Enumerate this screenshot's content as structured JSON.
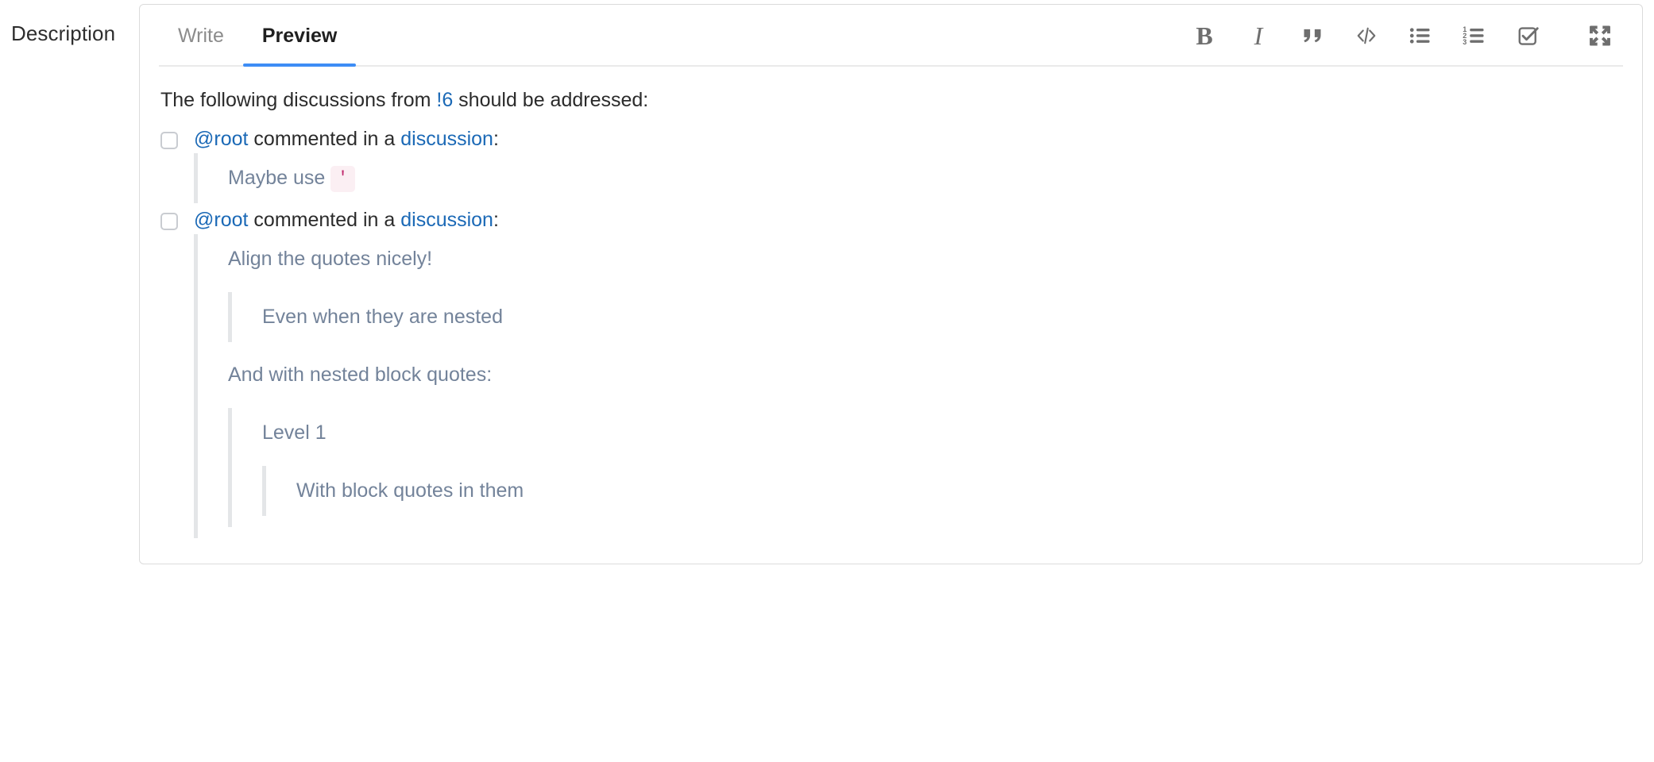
{
  "field": {
    "label": "Description"
  },
  "editor": {
    "tabs": [
      {
        "label": "Write",
        "active": false
      },
      {
        "label": "Preview",
        "active": true
      }
    ],
    "active_tab": "Preview",
    "accent_color": "#3d8df5",
    "toolbar": [
      {
        "name": "bold-icon",
        "label": "B",
        "title": "Add bold text"
      },
      {
        "name": "italic-icon",
        "label": "I",
        "title": "Add italic text"
      },
      {
        "name": "quote-icon",
        "label": "”",
        "title": "Insert a quote"
      },
      {
        "name": "code-icon",
        "label": "</>",
        "title": "Insert code"
      },
      {
        "name": "bullet-list-icon",
        "label": "",
        "title": "Add a bullet list"
      },
      {
        "name": "numbered-list-icon",
        "label": "",
        "title": "Add a numbered list"
      },
      {
        "name": "task-list-icon",
        "label": "",
        "title": "Add a task list"
      },
      {
        "name": "fullscreen-icon",
        "label": "",
        "title": "Go full screen"
      }
    ]
  },
  "preview": {
    "intro": {
      "before": "The following discussions from ",
      "link": "!6",
      "after": " should be addressed:"
    },
    "tasks": [
      {
        "checked": false,
        "user": "@root",
        "mid": " commented in a ",
        "link": "discussion",
        "tail": ":",
        "quote": {
          "text_before_code": "Maybe use ",
          "code": "'",
          "nested": []
        }
      },
      {
        "checked": false,
        "user": "@root",
        "mid": " commented in a ",
        "link": "discussion",
        "tail": ":",
        "quote": {
          "line1": "Align the quotes nicely!",
          "nested1": "Even when they are nested",
          "line2": "And with nested block quotes:",
          "nested2_line": "Level 1",
          "nested3_line": "With block quotes in them"
        }
      }
    ]
  },
  "colors": {
    "link": "#1b69b6",
    "quote_text": "#73839a",
    "quote_bar": "#e4e6e8",
    "code_bg": "#fbeff3",
    "code_fg": "#c0266b",
    "card_border": "#dbdbdb"
  }
}
